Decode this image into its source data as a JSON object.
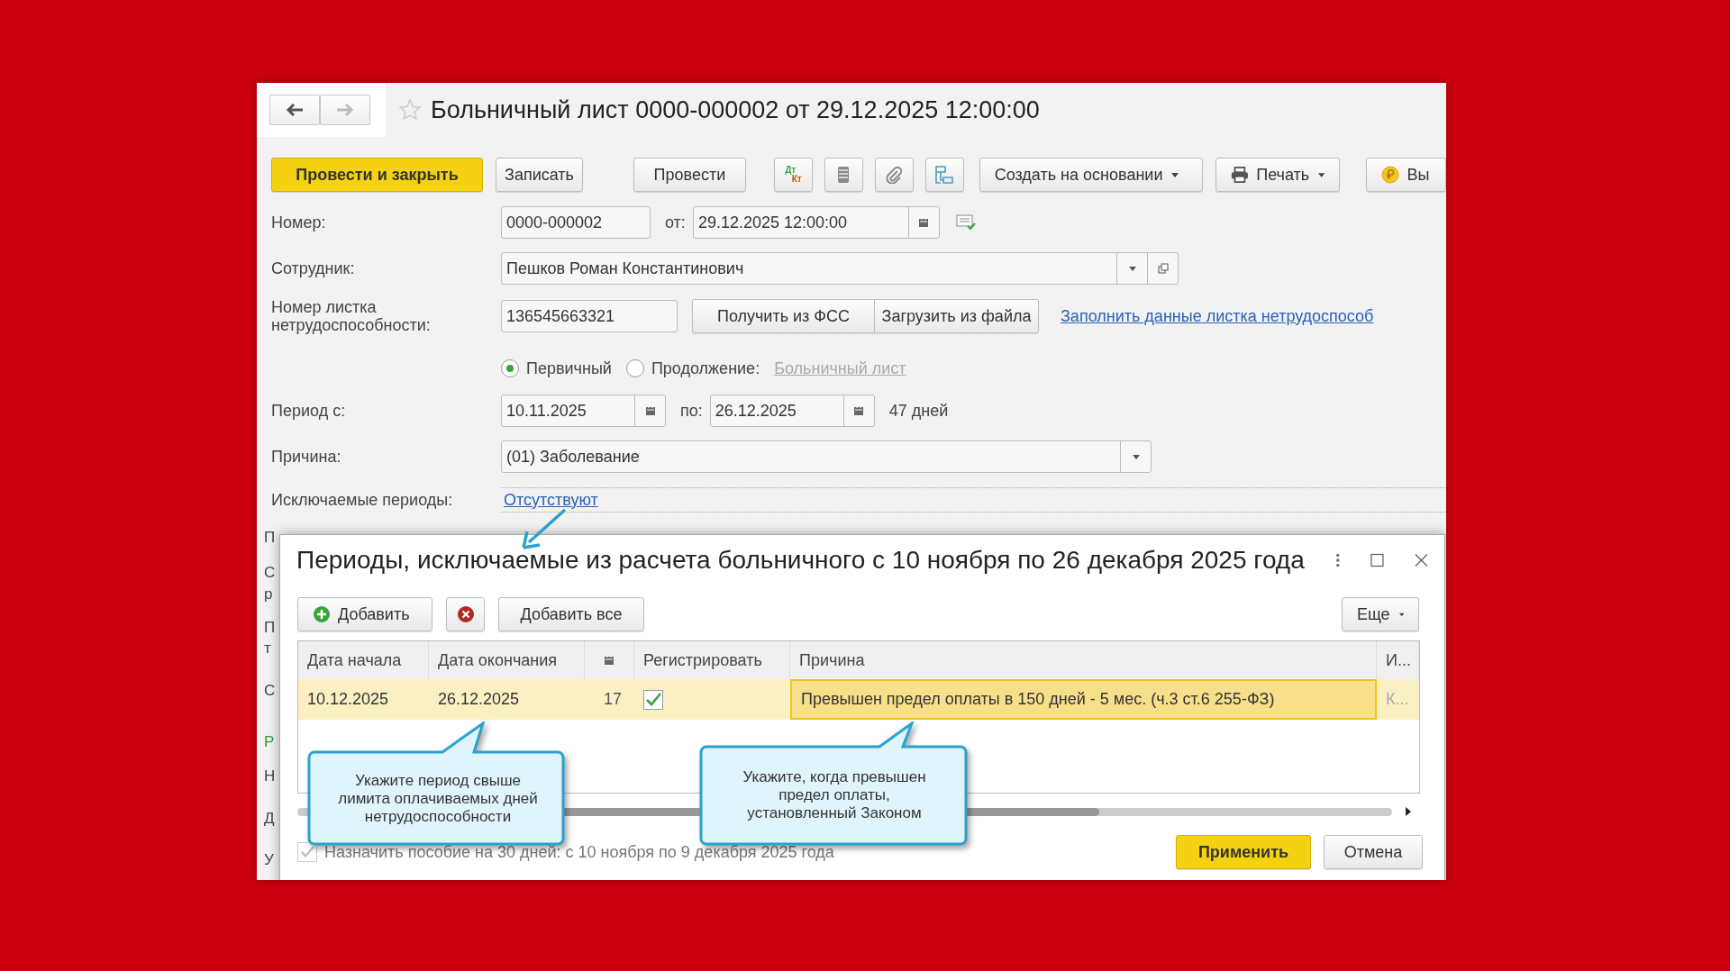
{
  "window": {
    "title": "Больничный лист 0000-000002 от 29.12.2025 12:00:00"
  },
  "toolbar": {
    "left_buttons": [
      {
        "label": "Провести и закрыть",
        "kind": "primary"
      },
      {
        "label": "Записать",
        "kind": "plain"
      },
      {
        "label": "Провести",
        "kind": "plain"
      }
    ],
    "accounting_button": {
      "debit": "Дт",
      "credit": "Кт"
    },
    "right_buttons": [
      {
        "label": "Создать на основании",
        "kind": "menu"
      },
      {
        "label": "Печать",
        "kind": "print"
      },
      {
        "label": "Вы",
        "kind": "pay"
      }
    ]
  },
  "form": {
    "number_label": "Номер:",
    "number": "0000-000002",
    "date_label": "от:",
    "date": "29.12.2025 12:00:00",
    "employee_label": "Сотрудник:",
    "employee": "Пешков Роман Константинович",
    "sheet_label": "Номер листка нетрудоспособности:",
    "sheet_number": "136545663321",
    "sheet_buttons": [
      "Получить из ФСС",
      "Загрузить из файла"
    ],
    "fill_link": "Заполнить данные листка нетрудоспособ",
    "sheet_types": [
      {
        "label": "Первичный",
        "selected": true
      },
      {
        "label": "Продолжение:",
        "selected": false
      }
    ],
    "continuation_link": {
      "label": "Больничный лист",
      "disabled": true
    },
    "period_label": "Период с:",
    "period_from": "10.11.2025",
    "period_to_label": "по:",
    "period_to": "26.12.2025",
    "duration": "47 дней",
    "reason_label": "Причина:",
    "reason": "(01) Заболевание",
    "excluded_label": "Исключаемые периоды:",
    "excluded_link": "Отсутствуют",
    "hidden_labels": [
      {
        "text": "П",
        "kind": "label"
      },
      {
        "text": "С",
        "kind": "label"
      },
      {
        "text": "р",
        "kind": "label"
      },
      {
        "text": "П",
        "kind": "label"
      },
      {
        "text": "т",
        "kind": "label"
      },
      {
        "text": "С",
        "kind": "label"
      },
      {
        "text": "Р",
        "kind": "section"
      },
      {
        "text": "Н",
        "kind": "label"
      },
      {
        "text": "Д",
        "kind": "label"
      },
      {
        "text": "У",
        "kind": "label"
      }
    ]
  },
  "dialog": {
    "title": "Периоды, исключаемые из расчета больничного с 10 ноября по 26 декабря 2025 года",
    "add_button": "Добавить",
    "add_all_button": "Добавить все",
    "more_button": "Еще",
    "table": {
      "columns": [
        {
          "label": "Дата начала",
          "kind": "text"
        },
        {
          "label": "Дата окончания",
          "kind": "text"
        },
        {
          "kind": "days"
        },
        {
          "label": "Регистрировать",
          "kind": "text"
        },
        {
          "label": "Причина",
          "kind": "text"
        },
        {
          "label": "И...",
          "kind": "text"
        }
      ],
      "rows": [
        {
          "start": "10.12.2025",
          "end": "26.12.2025",
          "days": "17",
          "register": true,
          "reason": "Превышен предел оплаты в 150 дней - 5 мес. (ч.3 ст.6 255-ФЗ)",
          "column_6": "К...",
          "selected": true
        }
      ]
    },
    "assign": {
      "label": "Назначить пособие на 30 дней: с 10 ноября по 9 декабря 2025 года",
      "checked": true,
      "disabled": true
    },
    "apply_button": "Применить",
    "cancel_button": "Отмена"
  },
  "callouts": [
    "Укажите период свыше лимита оплачиваемых дней нетрудоспособности",
    "Укажите, когда превышен предел оплаты, установленный Законом"
  ]
}
